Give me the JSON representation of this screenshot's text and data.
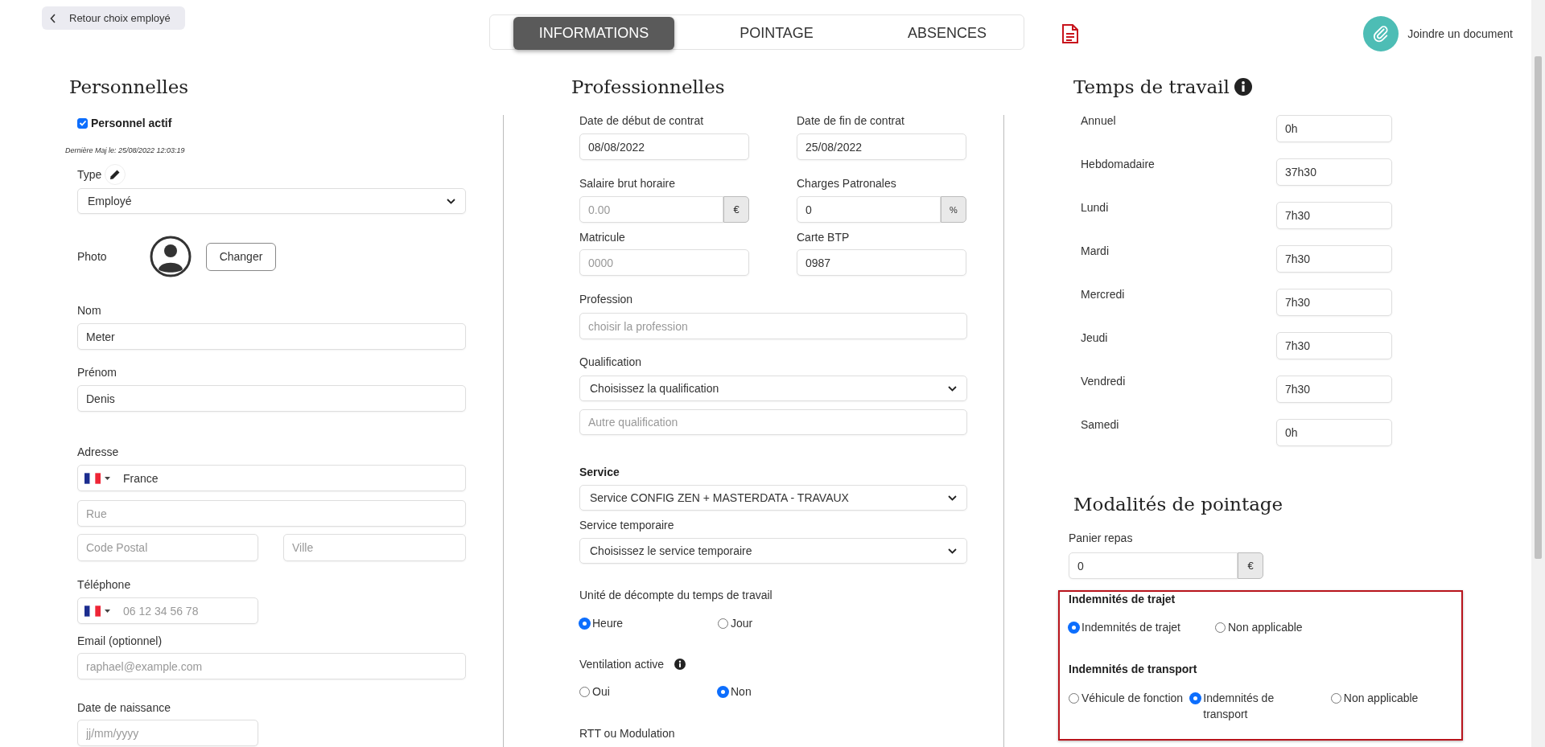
{
  "back_button": {
    "label": "Retour choix employé"
  },
  "tabs": [
    {
      "label": "INFORMATIONS",
      "selected": true
    },
    {
      "label": "POINTAGE",
      "selected": false
    },
    {
      "label": "ABSENCES",
      "selected": false
    }
  ],
  "attach": {
    "label": "Joindre un document"
  },
  "personnelles": {
    "title": "Personnelles",
    "active": {
      "label": "Personnel actif",
      "checked": true
    },
    "last_update": "Dernière Maj le: 25/08/2022 12:03:19",
    "type": {
      "label": "Type",
      "value": "Employé"
    },
    "photo": {
      "label": "Photo",
      "button": "Changer"
    },
    "nom": {
      "label": "Nom",
      "value": "Meter"
    },
    "prenom": {
      "label": "Prénom",
      "value": "Denis"
    },
    "adresse": {
      "label": "Adresse",
      "country": "France",
      "street": {
        "placeholder": "Rue"
      },
      "postal_code": {
        "placeholder": "Code Postal"
      },
      "city": {
        "placeholder": "Ville"
      }
    },
    "telephone": {
      "label": "Téléphone",
      "placeholder": "06 12 34 56 78"
    },
    "email": {
      "label": "Email (optionnel)",
      "placeholder": "raphael@example.com"
    },
    "birth_date": {
      "label": "Date de naissance",
      "placeholder": "jj/mm/yyyy"
    }
  },
  "professionnelles": {
    "title": "Professionnelles",
    "contract_start": {
      "label": "Date de début de contrat",
      "value": "08/08/2022"
    },
    "contract_end": {
      "label": "Date de fin de contrat",
      "value": "25/08/2022"
    },
    "hourly_wage": {
      "label": "Salaire brut horaire",
      "placeholder": "0.00",
      "unit": "€"
    },
    "employer_charges": {
      "label": "Charges Patronales",
      "value": "0",
      "unit": "%"
    },
    "matricule": {
      "label": "Matricule",
      "placeholder": "0000"
    },
    "carte_btp": {
      "label": "Carte BTP",
      "value": "0987"
    },
    "profession": {
      "label": "Profession",
      "placeholder": "choisir la profession"
    },
    "qualification": {
      "label": "Qualification",
      "value": "Choisissez la qualification",
      "other": {
        "placeholder": "Autre qualification"
      }
    },
    "service": {
      "label": "Service",
      "value": "Service CONFIG ZEN + MASTERDATA - TRAVAUX"
    },
    "temp_service": {
      "label": "Service temporaire",
      "value": "Choisissez le service temporaire"
    },
    "time_unit": {
      "label": "Unité de décompte du temps de travail",
      "options": [
        {
          "label": "Heure",
          "selected": true
        },
        {
          "label": "Jour",
          "selected": false
        }
      ]
    },
    "ventilation": {
      "label": "Ventilation active",
      "options": [
        {
          "label": "Oui",
          "selected": false
        },
        {
          "label": "Non",
          "selected": true
        }
      ]
    },
    "rtt": {
      "label": "RTT ou Modulation"
    }
  },
  "temps_de_travail": {
    "title": "Temps de travail",
    "rows": [
      {
        "label": "Annuel",
        "value": "0h"
      },
      {
        "label": "Hebdomadaire",
        "value": "37h30"
      },
      {
        "label": "Lundi",
        "value": "7h30"
      },
      {
        "label": "Mardi",
        "value": "7h30"
      },
      {
        "label": "Mercredi",
        "value": "7h30"
      },
      {
        "label": "Jeudi",
        "value": "7h30"
      },
      {
        "label": "Vendredi",
        "value": "7h30"
      },
      {
        "label": "Samedi",
        "value": "0h"
      }
    ]
  },
  "modalites": {
    "title": "Modalités de pointage",
    "meal": {
      "label": "Panier repas",
      "value": "0",
      "unit": "€"
    },
    "groups": [
      {
        "label": "Indemnités de trajet",
        "options": [
          {
            "label": "Indemnités de trajet",
            "selected": true
          },
          {
            "label": "Non applicable",
            "selected": false
          }
        ]
      },
      {
        "label": "Indemnités de transport",
        "options": [
          {
            "label": "Véhicule de fonction",
            "selected": false
          },
          {
            "label": "Indemnités de transport",
            "selected": true
          },
          {
            "label": "Non applicable",
            "selected": false
          }
        ]
      }
    ]
  }
}
